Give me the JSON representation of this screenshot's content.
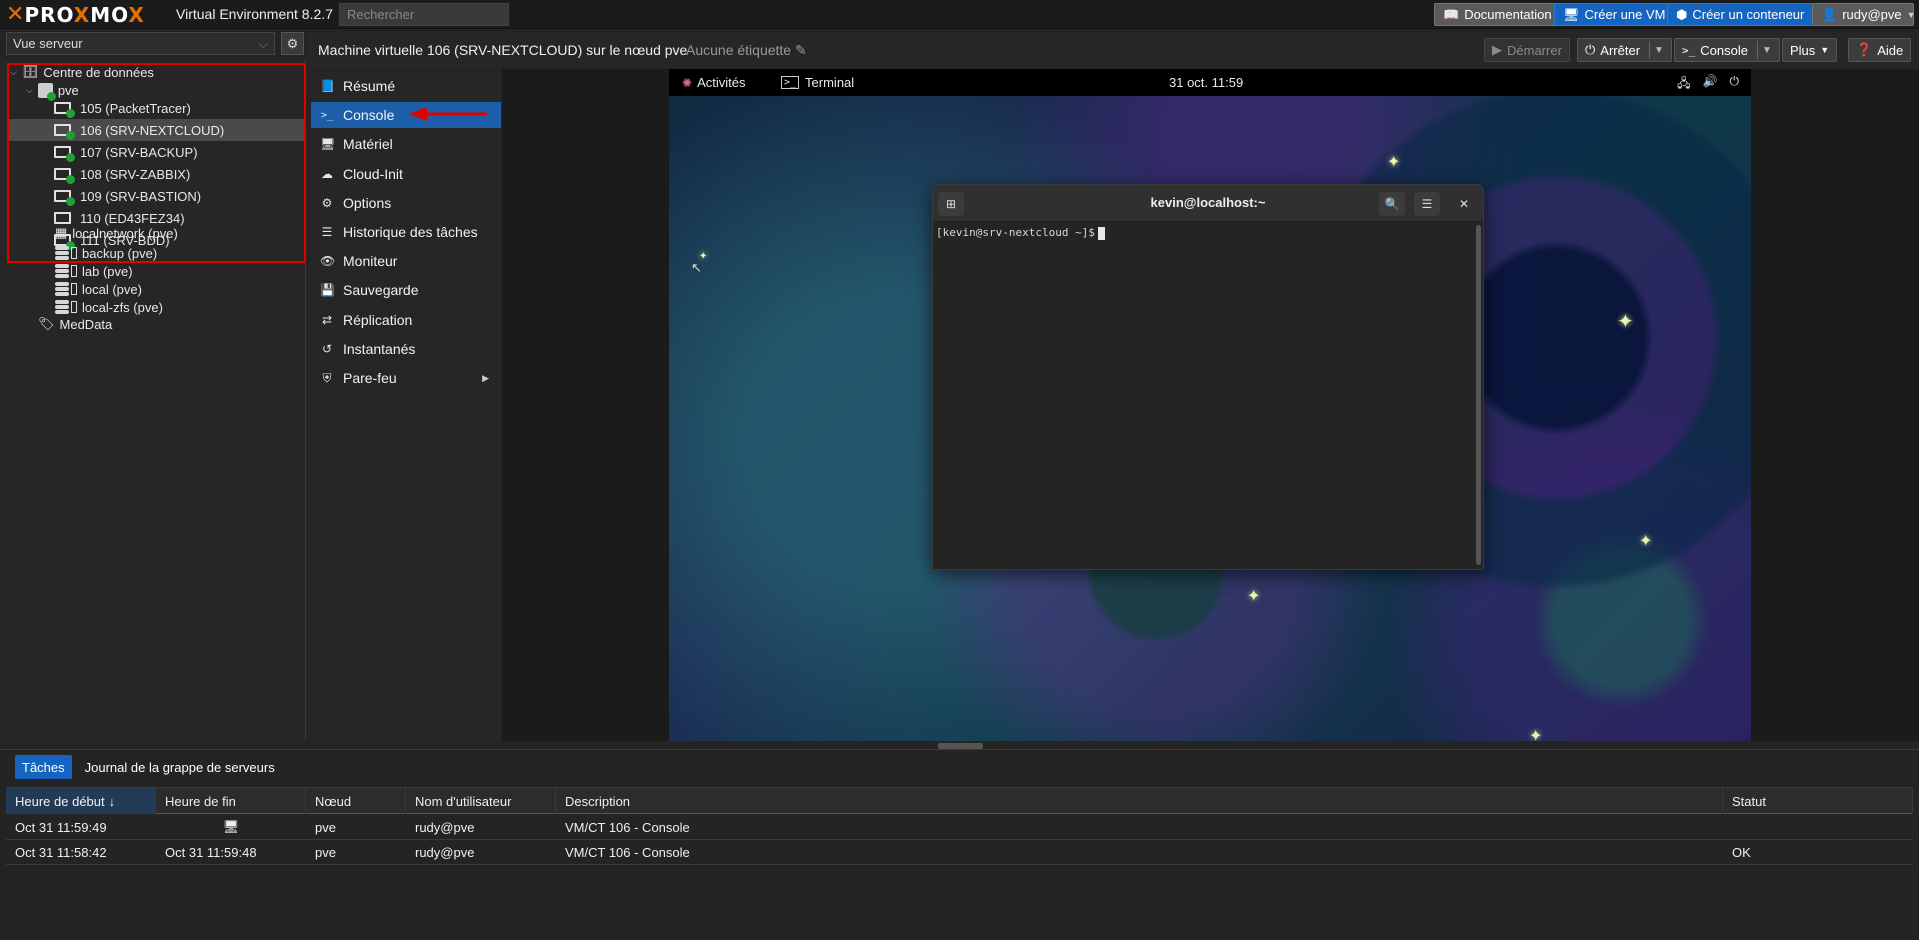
{
  "app": {
    "logo_text": "PROXMOX",
    "version": "Virtual Environment 8.2.7",
    "search_placeholder": "Rechercher"
  },
  "topbar": {
    "documentation": "Documentation",
    "create_vm": "Créer une VM",
    "create_ct": "Créer un conteneur",
    "user": "rudy@pve"
  },
  "sidebar": {
    "view": "Vue serveur",
    "datacenter": "Centre de données",
    "node": "pve",
    "vms": [
      {
        "label": "105 (PacketTracer)",
        "running": true
      },
      {
        "label": "106 (SRV-NEXTCLOUD)",
        "running": true,
        "selected": true
      },
      {
        "label": "107 (SRV-BACKUP)",
        "running": true
      },
      {
        "label": "108 (SRV-ZABBIX)",
        "running": true
      },
      {
        "label": "109 (SRV-BASTION)",
        "running": true
      },
      {
        "label": "110 (ED43FEZ34)",
        "running": false
      },
      {
        "label": "111 (SRV-BDD)",
        "running": true
      }
    ],
    "network": "localnetwork (pve)",
    "storages": [
      "backup (pve)",
      "lab (pve)",
      "local (pve)",
      "local-zfs (pve)"
    ],
    "pool": "MedData"
  },
  "header": {
    "title": "Machine virtuelle 106 (SRV-NEXTCLOUD) sur le nœud pve",
    "tags": "Aucune étiquette",
    "start": "Démarrer",
    "stop": "Arrêter",
    "console": "Console",
    "more": "Plus",
    "help": "Aide"
  },
  "menu": [
    {
      "label": "Résumé",
      "icon": "book-icon"
    },
    {
      "label": "Console",
      "icon": "terminal-icon",
      "active": true
    },
    {
      "label": "Matériel",
      "icon": "monitor-icon"
    },
    {
      "label": "Cloud-Init",
      "icon": "cloud-icon"
    },
    {
      "label": "Options",
      "icon": "gear-icon"
    },
    {
      "label": "Historique des tâches",
      "icon": "list-icon"
    },
    {
      "label": "Moniteur",
      "icon": "eye-icon"
    },
    {
      "label": "Sauvegarde",
      "icon": "floppy-icon"
    },
    {
      "label": "Réplication",
      "icon": "retweet-icon"
    },
    {
      "label": "Instantanés",
      "icon": "history-icon"
    },
    {
      "label": "Pare-feu",
      "icon": "shield-icon",
      "has_submenu": true
    }
  ],
  "gnome": {
    "activities": "Activités",
    "app": "Terminal",
    "clock": "31 oct.  11:59"
  },
  "terminal": {
    "title": "kevin@localhost:~",
    "prompt": "[kevin@srv-nextcloud ~]$"
  },
  "bottom": {
    "tabs": [
      "Tâches",
      "Journal de la grappe de serveurs"
    ],
    "columns": [
      "Heure de début",
      "Heure de fin",
      "Nœud",
      "Nom d'utilisateur",
      "Description",
      "Statut"
    ],
    "rows": [
      {
        "start": "Oct 31 11:59:49",
        "end": "",
        "end_icon": "monitor-icon",
        "node": "pve",
        "user": "rudy@pve",
        "desc": "VM/CT 106 - Console",
        "status": ""
      },
      {
        "start": "Oct 31 11:58:42",
        "end": "Oct 31 11:59:48",
        "node": "pve",
        "user": "rudy@pve",
        "desc": "VM/CT 106 - Console",
        "status": "OK"
      }
    ]
  },
  "colors": {
    "accent": "#1565c0",
    "proxmox_orange": "#e57000",
    "running": "#21a03a",
    "annotation_red": "#e00000"
  }
}
